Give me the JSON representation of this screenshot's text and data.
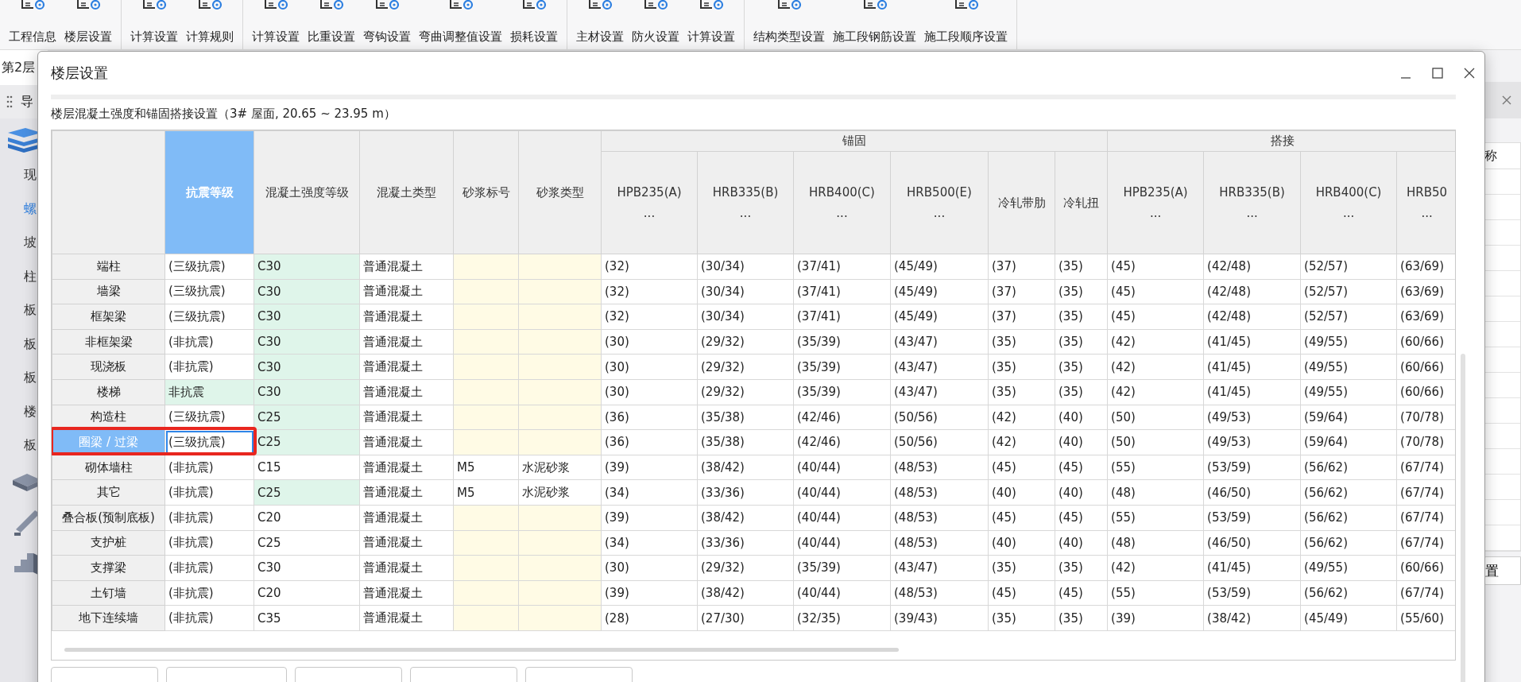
{
  "toolbar": {
    "groups": [
      {
        "items": [
          {
            "label": "工程信息"
          },
          {
            "label": "楼层设置"
          }
        ]
      },
      {
        "items": [
          {
            "label": "计算设置"
          },
          {
            "label": "计算规则"
          }
        ]
      },
      {
        "items": [
          {
            "label": "计算设置"
          },
          {
            "label": "比重设置"
          },
          {
            "label": "弯钩设置"
          },
          {
            "label": "弯曲调整值设置"
          },
          {
            "label": "损耗设置"
          }
        ]
      },
      {
        "items": [
          {
            "label": "主材设置"
          },
          {
            "label": "防火设置"
          },
          {
            "label": "计算设置"
          }
        ]
      },
      {
        "items": [
          {
            "label": "结构类型设置"
          },
          {
            "label": "施工段钢筋设置"
          },
          {
            "label": "施工段顺序设置"
          }
        ]
      }
    ]
  },
  "left_panel": {
    "floor": "第2层",
    "header": "导",
    "items": [
      {
        "label": "现",
        "selected": false
      },
      {
        "label": "螺",
        "selected": true
      },
      {
        "label": "坡",
        "selected": false
      },
      {
        "label": "柱",
        "selected": false
      },
      {
        "label": "板",
        "selected": false
      },
      {
        "label": "板",
        "selected": false
      },
      {
        "label": "板",
        "selected": false
      },
      {
        "label": "楼",
        "selected": false
      },
      {
        "label": "板",
        "selected": false
      }
    ]
  },
  "right_panel": {
    "column_header": "称",
    "button": "置"
  },
  "dialog": {
    "title": "楼层设置",
    "subtitle": "楼层混凝土强度和锚固搭接设置（3#  屋面, 20.65 ~ 23.95 m）",
    "columns": [
      {
        "label": "抗震等级",
        "selected": true
      },
      {
        "label": "混凝土强度等级",
        "selected": false
      },
      {
        "label": "混凝土类型",
        "selected": false
      },
      {
        "label": "砂浆标号",
        "selected": false
      },
      {
        "label": "砂浆类型",
        "selected": false
      }
    ],
    "groups": [
      {
        "label": "锚固",
        "columns": [
          {
            "label": "HPB235(A)",
            "sub": "..."
          },
          {
            "label": "HRB335(B)",
            "sub": "..."
          },
          {
            "label": "HRB400(C)",
            "sub": "..."
          },
          {
            "label": "HRB500(E)",
            "sub": "..."
          },
          {
            "label": "冷轧带肋"
          },
          {
            "label": "冷轧扭"
          }
        ]
      },
      {
        "label": "搭接",
        "columns": [
          {
            "label": "HPB235(A)",
            "sub": "..."
          },
          {
            "label": "HRB335(B)",
            "sub": "..."
          },
          {
            "label": "HRB400(C)",
            "sub": "..."
          },
          {
            "label": "HRB50",
            "sub": "..."
          }
        ]
      }
    ],
    "rows": [
      {
        "name": "端柱",
        "selected": false,
        "annotated": false,
        "seismic": {
          "text": "(三级抗震)",
          "highlight": false
        },
        "strength": {
          "text": "C30",
          "highlight": true
        },
        "concrete": "普通混凝土",
        "values": [
          "(32)",
          "(30/34)",
          "(37/41)",
          "(45/49)",
          "(37)",
          "(35)",
          "(45)",
          "(42/48)",
          "(52/57)",
          "(63/69)"
        ]
      },
      {
        "name": "墙梁",
        "selected": false,
        "annotated": false,
        "seismic": {
          "text": "(三级抗震)",
          "highlight": false
        },
        "strength": {
          "text": "C30",
          "highlight": true
        },
        "concrete": "普通混凝土",
        "values": [
          "(32)",
          "(30/34)",
          "(37/41)",
          "(45/49)",
          "(37)",
          "(35)",
          "(45)",
          "(42/48)",
          "(52/57)",
          "(63/69)"
        ]
      },
      {
        "name": "框架梁",
        "selected": false,
        "annotated": false,
        "seismic": {
          "text": "(三级抗震)",
          "highlight": false
        },
        "strength": {
          "text": "C30",
          "highlight": true
        },
        "concrete": "普通混凝土",
        "values": [
          "(32)",
          "(30/34)",
          "(37/41)",
          "(45/49)",
          "(37)",
          "(35)",
          "(45)",
          "(42/48)",
          "(52/57)",
          "(63/69)"
        ]
      },
      {
        "name": "非框架梁",
        "selected": false,
        "annotated": false,
        "seismic": {
          "text": "(非抗震)",
          "highlight": false
        },
        "strength": {
          "text": "C30",
          "highlight": true
        },
        "concrete": "普通混凝土",
        "values": [
          "(30)",
          "(29/32)",
          "(35/39)",
          "(43/47)",
          "(35)",
          "(35)",
          "(42)",
          "(41/45)",
          "(49/55)",
          "(60/66)"
        ]
      },
      {
        "name": "现浇板",
        "selected": false,
        "annotated": false,
        "seismic": {
          "text": "(非抗震)",
          "highlight": false
        },
        "strength": {
          "text": "C30",
          "highlight": true
        },
        "concrete": "普通混凝土",
        "values": [
          "(30)",
          "(29/32)",
          "(35/39)",
          "(43/47)",
          "(35)",
          "(35)",
          "(42)",
          "(41/45)",
          "(49/55)",
          "(60/66)"
        ]
      },
      {
        "name": "楼梯",
        "selected": false,
        "annotated": false,
        "seismic": {
          "text": "非抗震",
          "highlight": true
        },
        "strength": {
          "text": "C30",
          "highlight": true
        },
        "concrete": "普通混凝土",
        "values": [
          "(30)",
          "(29/32)",
          "(35/39)",
          "(43/47)",
          "(35)",
          "(35)",
          "(42)",
          "(41/45)",
          "(49/55)",
          "(60/66)"
        ]
      },
      {
        "name": "构造柱",
        "selected": false,
        "annotated": false,
        "seismic": {
          "text": "(三级抗震)",
          "highlight": false
        },
        "strength": {
          "text": "C25",
          "highlight": true
        },
        "concrete": "普通混凝土",
        "values": [
          "(36)",
          "(35/38)",
          "(42/46)",
          "(50/56)",
          "(42)",
          "(40)",
          "(50)",
          "(49/53)",
          "(59/64)",
          "(70/78)"
        ]
      },
      {
        "name": "圈梁 / 过梁",
        "selected": true,
        "annotated": true,
        "seismic": {
          "text": "(三级抗震)",
          "highlight": false
        },
        "strength": {
          "text": "C25",
          "highlight": true
        },
        "concrete": "普通混凝土",
        "values": [
          "(36)",
          "(35/38)",
          "(42/46)",
          "(50/56)",
          "(42)",
          "(40)",
          "(50)",
          "(49/53)",
          "(59/64)",
          "(70/78)"
        ]
      },
      {
        "name": "砌体墙柱",
        "selected": false,
        "annotated": false,
        "seismic": {
          "text": "(非抗震)",
          "highlight": false
        },
        "strength": {
          "text": "C15",
          "highlight": false
        },
        "concrete": "普通混凝土",
        "mortar_grade": "M5",
        "mortar_type": "水泥砂浆",
        "values": [
          "(39)",
          "(38/42)",
          "(40/44)",
          "(48/53)",
          "(45)",
          "(45)",
          "(55)",
          "(53/59)",
          "(56/62)",
          "(67/74)"
        ]
      },
      {
        "name": "其它",
        "selected": false,
        "annotated": false,
        "seismic": {
          "text": "(非抗震)",
          "highlight": false
        },
        "strength": {
          "text": "C25",
          "highlight": true
        },
        "concrete": "普通混凝土",
        "mortar_grade": "M5",
        "mortar_type": "水泥砂浆",
        "values": [
          "(34)",
          "(33/36)",
          "(40/44)",
          "(48/53)",
          "(40)",
          "(40)",
          "(48)",
          "(46/50)",
          "(56/62)",
          "(67/74)"
        ]
      },
      {
        "name": "叠合板(预制底板)",
        "selected": false,
        "annotated": false,
        "seismic": {
          "text": "(非抗震)",
          "highlight": false
        },
        "strength": {
          "text": "C20",
          "highlight": false
        },
        "concrete": "普通混凝土",
        "values": [
          "(39)",
          "(38/42)",
          "(40/44)",
          "(48/53)",
          "(45)",
          "(45)",
          "(55)",
          "(53/59)",
          "(56/62)",
          "(67/74)"
        ]
      },
      {
        "name": "支护桩",
        "selected": false,
        "annotated": false,
        "seismic": {
          "text": "(非抗震)",
          "highlight": false
        },
        "strength": {
          "text": "C25",
          "highlight": false
        },
        "concrete": "普通混凝土",
        "values": [
          "(34)",
          "(33/36)",
          "(40/44)",
          "(48/53)",
          "(40)",
          "(40)",
          "(48)",
          "(46/50)",
          "(56/62)",
          "(67/74)"
        ]
      },
      {
        "name": "支撑梁",
        "selected": false,
        "annotated": false,
        "seismic": {
          "text": "(非抗震)",
          "highlight": false
        },
        "strength": {
          "text": "C30",
          "highlight": false
        },
        "concrete": "普通混凝土",
        "values": [
          "(30)",
          "(29/32)",
          "(35/39)",
          "(43/47)",
          "(35)",
          "(35)",
          "(42)",
          "(41/45)",
          "(49/55)",
          "(60/66)"
        ]
      },
      {
        "name": "土钉墙",
        "selected": false,
        "annotated": false,
        "seismic": {
          "text": "(非抗震)",
          "highlight": false
        },
        "strength": {
          "text": "C20",
          "highlight": false
        },
        "concrete": "普通混凝土",
        "values": [
          "(39)",
          "(38/42)",
          "(40/44)",
          "(48/53)",
          "(45)",
          "(45)",
          "(55)",
          "(53/59)",
          "(56/62)",
          "(67/74)"
        ]
      },
      {
        "name": "地下连续墙",
        "selected": false,
        "annotated": false,
        "seismic": {
          "text": "(非抗震)",
          "highlight": false
        },
        "strength": {
          "text": "C35",
          "highlight": false
        },
        "concrete": "普通混凝土",
        "values": [
          "(28)",
          "(27/30)",
          "(32/35)",
          "(39/43)",
          "(35)",
          "(35)",
          "(39)",
          "(38/42)",
          "(45/49)",
          "(55/60)"
        ]
      }
    ]
  }
}
